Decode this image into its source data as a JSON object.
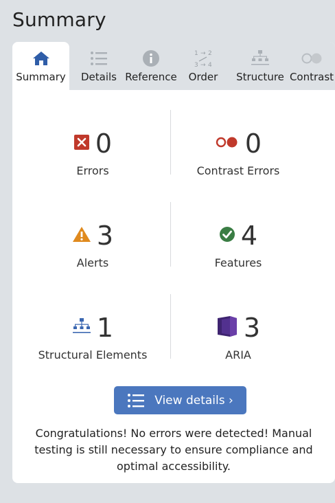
{
  "panel": {
    "title": "Summary"
  },
  "tabs": [
    {
      "label": "Summary",
      "icon": "home-icon",
      "active": true
    },
    {
      "label": "Details",
      "icon": "list-icon",
      "active": false
    },
    {
      "label": "Reference",
      "icon": "info-icon",
      "active": false
    },
    {
      "label": "Order",
      "icon": "order-icon",
      "active": false
    },
    {
      "label": "Structure",
      "icon": "structure-icon",
      "active": false
    },
    {
      "label": "Contrast",
      "icon": "contrast-icon",
      "active": false
    }
  ],
  "stats": {
    "errors": {
      "count": "0",
      "label": "Errors",
      "icon": "error-icon",
      "color": "#c0392b"
    },
    "contrast_errors": {
      "count": "0",
      "label": "Contrast Errors",
      "icon": "contrast-error-icon",
      "color": "#c0392b"
    },
    "alerts": {
      "count": "3",
      "label": "Alerts",
      "icon": "alert-icon",
      "color": "#e08a1e"
    },
    "features": {
      "count": "4",
      "label": "Features",
      "icon": "feature-icon",
      "color": "#3a7d44"
    },
    "structural": {
      "count": "1",
      "label": "Structural Elements",
      "icon": "structure-icon",
      "color": "#3b67b1"
    },
    "aria": {
      "count": "3",
      "label": "ARIA",
      "icon": "aria-icon",
      "color": "#4a2c7a"
    }
  },
  "actions": {
    "view_details_label": "View details ›"
  },
  "message": "Congratulations! No errors were detected! Manual testing is still necessary to ensure compliance and optimal accessibility."
}
